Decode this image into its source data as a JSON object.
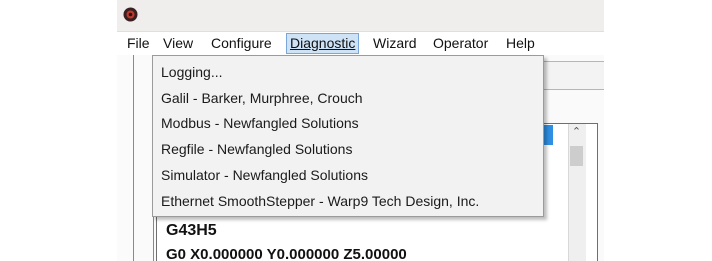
{
  "menubar": {
    "items": [
      "File",
      "View",
      "Configure",
      "Diagnostic",
      "Wizard",
      "Operator",
      "Help"
    ],
    "active_index": 3
  },
  "diagnostic_menu": {
    "items": [
      "Logging...",
      "Galil - Barker, Murphree, Crouch",
      "Modbus - Newfangled Solutions",
      "Regfile - Newfangled Solutions",
      "Simulator - Newfangled Solutions",
      "Ethernet SmoothStepper - Warp9 Tech Design, Inc."
    ]
  },
  "gcode": {
    "lines": [
      "G43H5",
      "G0 X0.000000 Y0.000000 Z5.00000"
    ]
  },
  "icons": {
    "app": "app-logo-icon",
    "scroll_up": "chevron-up-icon"
  },
  "colors": {
    "menu_highlight_bg": "#cfe3f7",
    "menu_highlight_border": "#7aa7d8",
    "selection_blue": "#2f8fe3"
  }
}
